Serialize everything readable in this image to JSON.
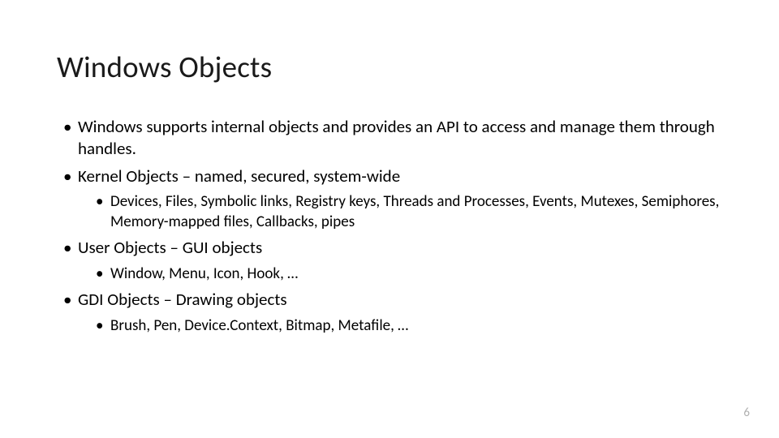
{
  "slide": {
    "title": "Windows Objects",
    "bullets": [
      {
        "text": "Windows supports internal objects and provides an API to access and manage them through handles.",
        "sub": []
      },
      {
        "text": "Kernel Objects – named, secured, system-wide",
        "sub": [
          "Devices, Files, Symbolic links, Registry keys, Threads and Processes, Events, Mutexes, Semiphores, Memory-mapped files, Callbacks, pipes"
        ]
      },
      {
        "text": "User Objects – GUI objects",
        "sub": [
          "Window, Menu, Icon, Hook, …"
        ]
      },
      {
        "text": "GDI Objects – Drawing objects",
        "sub": [
          "Brush, Pen, Device.Context, Bitmap, Metafile, …"
        ]
      }
    ],
    "page_number": "6"
  }
}
